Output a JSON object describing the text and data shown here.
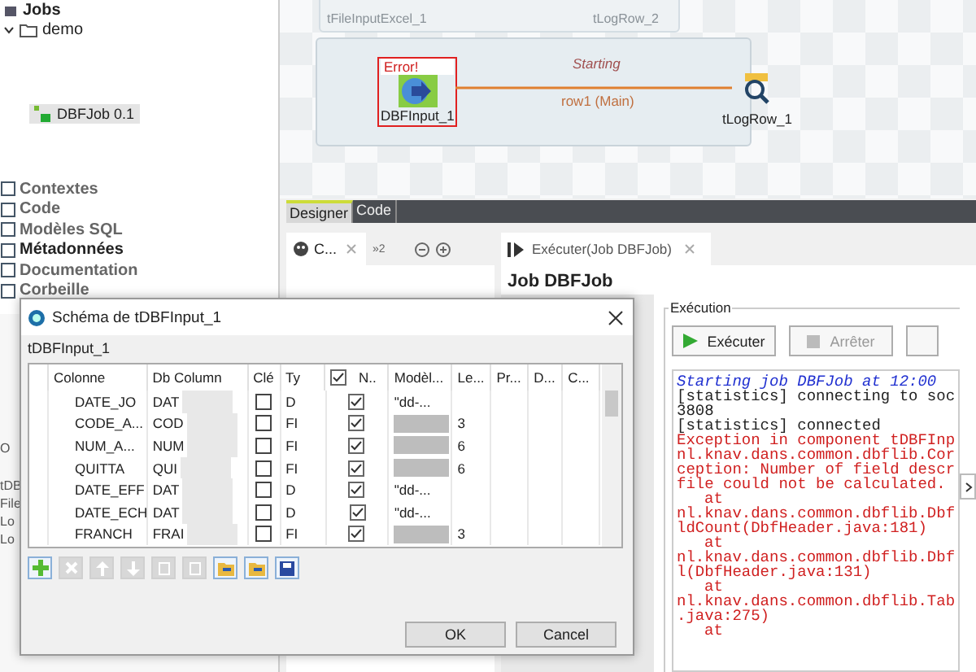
{
  "sidebar": {
    "tree": [
      {
        "label": "Jobs",
        "children": [
          {
            "label": "demo",
            "children": [
              {
                "label": "DBFJob 0.1",
                "selected": true
              }
            ]
          }
        ]
      }
    ],
    "sections": [
      {
        "label": "Contextes",
        "bold": false
      },
      {
        "label": "Code",
        "bold": false
      },
      {
        "label": "Modèles SQL",
        "bold": false
      },
      {
        "label": "Métadonnées",
        "bold": true
      },
      {
        "label": "Documentation",
        "bold": false
      },
      {
        "label": "Corbeille",
        "bold": false
      }
    ]
  },
  "outline": {
    "items": [
      "O",
      "tDB",
      "File",
      "Lo",
      "Lo"
    ]
  },
  "canvas": {
    "faded_subjob": {
      "nodes": [
        "tFileInputExcel_1",
        "tLogRow_2"
      ]
    },
    "subjob": {
      "error_label": "Error!",
      "source": "DBFInput_1",
      "target": "tLogRow_1",
      "status": "Starting",
      "link": "row1 (Main)"
    }
  },
  "editor_tabs": [
    {
      "label": "Designer",
      "selected": true
    },
    {
      "label": "Code",
      "selected": false
    }
  ],
  "palette": {
    "tab": "C...",
    "overflow": "»2"
  },
  "run_panel": {
    "tab": "Exécuter(Job DBFJob)",
    "heading": "Job DBFJob",
    "group": "Exécution",
    "buttons": [
      {
        "label": "Exécuter",
        "disabled": false
      },
      {
        "label": "Arrêter",
        "disabled": true
      }
    ],
    "console": [
      {
        "text": "Starting job DBFJob at 12:00",
        "kind": "info"
      },
      {
        "text": "[statistics] connecting to soc",
        "kind": "plain"
      },
      {
        "text": "3808",
        "kind": "plain"
      },
      {
        "text": "[statistics] connected",
        "kind": "plain"
      },
      {
        "text": "Exception in component tDBFInp",
        "kind": "error"
      },
      {
        "text": "nl.knav.dans.common.dbflib.Cor",
        "kind": "error"
      },
      {
        "text": "ception: Number of field descr",
        "kind": "error"
      },
      {
        "text": "file could not be calculated.",
        "kind": "error"
      },
      {
        "text": "at",
        "kind": "error_at"
      },
      {
        "text": "nl.knav.dans.common.dbflib.Dbf",
        "kind": "error"
      },
      {
        "text": "ldCount(DbfHeader.java:181)",
        "kind": "error"
      },
      {
        "text": "at",
        "kind": "error_at"
      },
      {
        "text": "nl.knav.dans.common.dbflib.Dbf",
        "kind": "error"
      },
      {
        "text": "l(DbfHeader.java:131)",
        "kind": "error"
      },
      {
        "text": "at",
        "kind": "error_at"
      },
      {
        "text": "nl.knav.dans.common.dbflib.Tab",
        "kind": "error"
      },
      {
        "text": ".java:275)",
        "kind": "error"
      },
      {
        "text": "at",
        "kind": "error_at"
      }
    ]
  },
  "dialog": {
    "title": "Schéma de tDBFInput_1",
    "component": "tDBFInput_1",
    "nullable_header_checked": true,
    "columns": [
      "Colonne",
      "Db Column",
      "Clé",
      "Ty",
      "N..",
      "Modèl...",
      "Le...",
      "Pr...",
      "D...",
      "C..."
    ],
    "rows": [
      {
        "name": "DATE_JO",
        "db": "DAT",
        "key": false,
        "type": "D",
        "nullable": true,
        "pattern": "\"dd-...",
        "length": ""
      },
      {
        "name": "CODE_A...",
        "db": "COD",
        "key": false,
        "type": "FI",
        "nullable": true,
        "pattern": "",
        "length": "3"
      },
      {
        "name": "NUM_A...",
        "db": "NUM",
        "key": false,
        "type": "FI",
        "nullable": true,
        "pattern": "",
        "length": "6"
      },
      {
        "name": "QUITTA",
        "db": "QUI",
        "key": false,
        "type": "FI",
        "nullable": true,
        "pattern": "",
        "length": "6"
      },
      {
        "name": "DATE_EFF",
        "db": "DAT",
        "key": false,
        "type": "D",
        "nullable": true,
        "pattern": "\"dd-...",
        "length": ""
      },
      {
        "name": "DATE_ECH",
        "db": "DAT",
        "key": false,
        "type": "D",
        "nullable": true,
        "pattern": "\"dd-...",
        "length": ""
      },
      {
        "name": "FRANCH",
        "db": "FRAI",
        "key": false,
        "type": "FI",
        "nullable": true,
        "pattern": "",
        "length": "3"
      }
    ],
    "tools": [
      {
        "kind": "add",
        "disabled": false
      },
      {
        "kind": "remove",
        "disabled": true
      },
      {
        "kind": "up",
        "disabled": true
      },
      {
        "kind": "down",
        "disabled": true
      },
      {
        "kind": "copy",
        "disabled": true
      },
      {
        "kind": "paste",
        "disabled": true
      },
      {
        "kind": "import",
        "disabled": false
      },
      {
        "kind": "export",
        "disabled": false
      },
      {
        "kind": "save",
        "disabled": false
      }
    ],
    "buttons": [
      "OK",
      "Cancel"
    ]
  }
}
